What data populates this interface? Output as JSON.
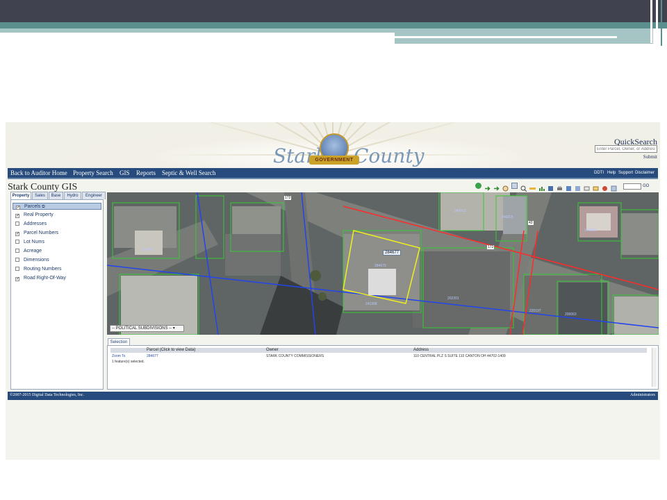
{
  "colors": {
    "nav": "#274b7c",
    "slide_band": "#40424f",
    "slide_accent": "#5b8f8e",
    "parcel_line": "#33cc33",
    "road_row": "#ff2a2a",
    "political": "#2244ee"
  },
  "logo": {
    "word_left": "Stark",
    "word_right": "County",
    "ribbon": "GOVERNMENT"
  },
  "quicksearch": {
    "label": "QuickSearch",
    "placeholder": "Enter Parcel, Owner, or Address",
    "submit": "Submit"
  },
  "nav": {
    "items": [
      "Back to Auditor Home",
      "Property Search",
      "GIS",
      "Reports",
      "Septic & Well Search"
    ],
    "right": [
      "DDTI",
      "Help",
      "Support",
      "Disclaimer"
    ]
  },
  "page_title": "Stark County GIS",
  "tabs": [
    "Property",
    "Sales",
    "Base",
    "Hydro",
    "Engineer"
  ],
  "layers": [
    {
      "label": "Parcels",
      "checked": true
    },
    {
      "label": "Real Property",
      "checked": true
    },
    {
      "label": "Addresses",
      "checked": false
    },
    {
      "label": "Parcel Numbers",
      "checked": true
    },
    {
      "label": "Lot Nums",
      "checked": false
    },
    {
      "label": "Acreage",
      "checked": false
    },
    {
      "label": "Dimensions",
      "checked": false
    },
    {
      "label": "Routing Numbers",
      "checked": false
    },
    {
      "label": "Road Right-Of-Way",
      "checked": true
    }
  ],
  "toolbar": {
    "icons": [
      "globe-icon",
      "zoom-in-arrow-icon",
      "pan-arrow-icon",
      "hand-icon",
      "zoom-box-icon",
      "zoom-out-icon",
      "measure-icon",
      "chart-icon",
      "layers-icon",
      "print-icon",
      "bookmark-icon",
      "identify-icon",
      "select-icon",
      "clear-icon",
      "label-icon",
      "settings-icon"
    ],
    "go": "GO"
  },
  "map": {
    "labels": [
      "284677",
      "172",
      "43",
      "172",
      "240062",
      "246815",
      "280442",
      "284670",
      "244558",
      "241998",
      "202201",
      "220197",
      "200063"
    ],
    "political_dropdown": "-- POLITICAL SUBDIVISIONS --"
  },
  "selection": {
    "tab": "Selection",
    "headers": [
      "Parcel (Click to view Data)",
      "Owner",
      "Address"
    ],
    "row": {
      "action": "Zoom To",
      "parcel": "284677",
      "owner": "STARK COUNTY COMMISSIONERS",
      "address": "110 CENTRAL PLZ S SUITE 110 CANTON OH 44702-1409"
    },
    "count": "1 feature(s) selected."
  },
  "footer": {
    "copyright": "©2007-2015 Digital Data Technologies, Inc.",
    "admin": "Administrators"
  }
}
